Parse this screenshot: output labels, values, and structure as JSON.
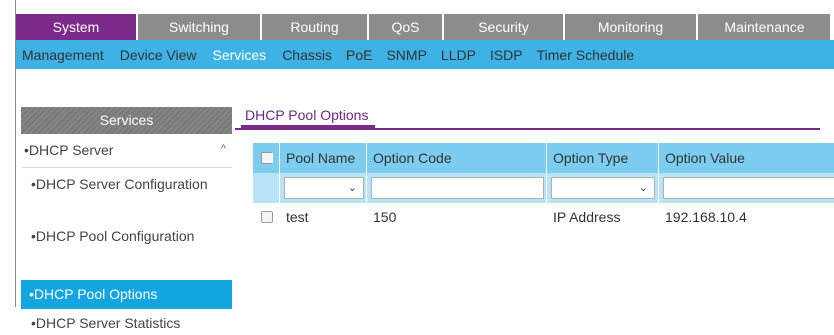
{
  "main_tabs": [
    "System",
    "Switching",
    "Routing",
    "QoS",
    "Security",
    "Monitoring",
    "Maintenance"
  ],
  "sub_nav": [
    "Management",
    "Device View",
    "Services",
    "Chassis",
    "PoE",
    "SNMP",
    "LLDP",
    "ISDP",
    "Timer Schedule"
  ],
  "sidebar": {
    "header": "Services",
    "group": "DHCP Server",
    "group_caret": "^",
    "items": [
      "DHCP Server Configuration",
      "DHCP Pool Configuration",
      "DHCP Pool Options",
      "DHCP Server Statistics"
    ]
  },
  "section_title": "DHCP Pool Options",
  "table": {
    "columns": [
      "Pool Name",
      "Option Code",
      "Option Type",
      "Option Value"
    ],
    "filter": {
      "pool_name": "",
      "option_code": "",
      "option_type": "",
      "option_value": ""
    },
    "rows": [
      {
        "pool_name": "test",
        "option_code": "150",
        "option_type": "IP Address",
        "option_value": "192.168.10.4"
      }
    ]
  },
  "colors": {
    "active_tab": "#7b2a8c",
    "sub_nav": "#3eb2e5",
    "sidebar_active": "#12a5e0",
    "table_header": "#7ccdf0",
    "filter_row": "#b9e3f6"
  }
}
